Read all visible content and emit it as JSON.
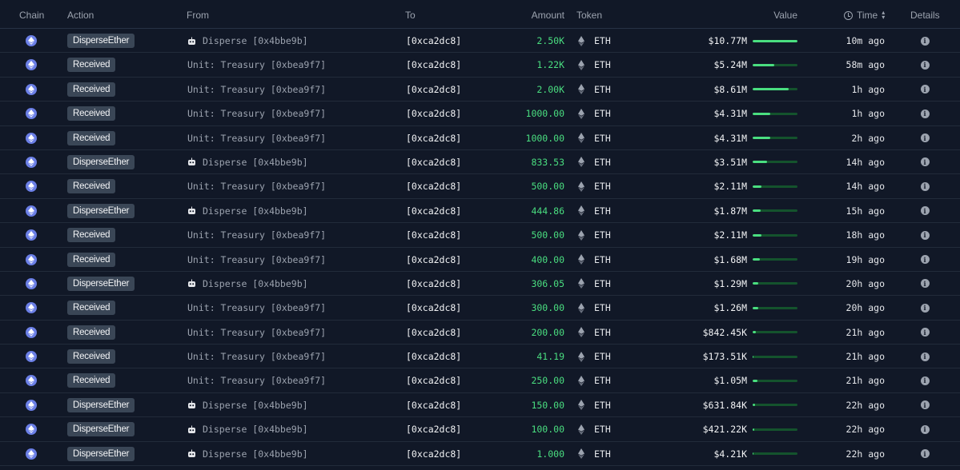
{
  "columns": {
    "chain": "Chain",
    "action": "Action",
    "from": "From",
    "to": "To",
    "amount": "Amount",
    "token": "Token",
    "value": "Value",
    "time": "Time",
    "details": "Details"
  },
  "icons": {
    "chain": "ethereum-chain-icon",
    "from_contract": "robot-icon",
    "token": "eth-diamond-icon",
    "details": "info-icon",
    "time_header": "clock-icon",
    "sort": "sort-icon"
  },
  "colors": {
    "background": "#111827",
    "amount_green": "#4ade80",
    "badge_bg": "#3a4656",
    "chain_icon": "#6b7fe6"
  },
  "rows": [
    {
      "action": "DisperseEther",
      "from": "Disperse [0x4bbe9b]",
      "from_contract": true,
      "to": "[0xca2dc8]",
      "amount": "2.50K",
      "token": "ETH",
      "value": "$10.77M",
      "value_fraction": 1.0,
      "time": "10m ago"
    },
    {
      "action": "Received",
      "from": "Unit: Treasury [0xbea9f7]",
      "from_contract": false,
      "to": "[0xca2dc8]",
      "amount": "1.22K",
      "token": "ETH",
      "value": "$5.24M",
      "value_fraction": 0.49,
      "time": "58m ago"
    },
    {
      "action": "Received",
      "from": "Unit: Treasury [0xbea9f7]",
      "from_contract": false,
      "to": "[0xca2dc8]",
      "amount": "2.00K",
      "token": "ETH",
      "value": "$8.61M",
      "value_fraction": 0.8,
      "time": "1h ago"
    },
    {
      "action": "Received",
      "from": "Unit: Treasury [0xbea9f7]",
      "from_contract": false,
      "to": "[0xca2dc8]",
      "amount": "1000.00",
      "token": "ETH",
      "value": "$4.31M",
      "value_fraction": 0.4,
      "time": "1h ago"
    },
    {
      "action": "Received",
      "from": "Unit: Treasury [0xbea9f7]",
      "from_contract": false,
      "to": "[0xca2dc8]",
      "amount": "1000.00",
      "token": "ETH",
      "value": "$4.31M",
      "value_fraction": 0.4,
      "time": "2h ago"
    },
    {
      "action": "DisperseEther",
      "from": "Disperse [0x4bbe9b]",
      "from_contract": true,
      "to": "[0xca2dc8]",
      "amount": "833.53",
      "token": "ETH",
      "value": "$3.51M",
      "value_fraction": 0.33,
      "time": "14h ago"
    },
    {
      "action": "Received",
      "from": "Unit: Treasury [0xbea9f7]",
      "from_contract": false,
      "to": "[0xca2dc8]",
      "amount": "500.00",
      "token": "ETH",
      "value": "$2.11M",
      "value_fraction": 0.2,
      "time": "14h ago"
    },
    {
      "action": "DisperseEther",
      "from": "Disperse [0x4bbe9b]",
      "from_contract": true,
      "to": "[0xca2dc8]",
      "amount": "444.86",
      "token": "ETH",
      "value": "$1.87M",
      "value_fraction": 0.17,
      "time": "15h ago"
    },
    {
      "action": "Received",
      "from": "Unit: Treasury [0xbea9f7]",
      "from_contract": false,
      "to": "[0xca2dc8]",
      "amount": "500.00",
      "token": "ETH",
      "value": "$2.11M",
      "value_fraction": 0.2,
      "time": "18h ago"
    },
    {
      "action": "Received",
      "from": "Unit: Treasury [0xbea9f7]",
      "from_contract": false,
      "to": "[0xca2dc8]",
      "amount": "400.00",
      "token": "ETH",
      "value": "$1.68M",
      "value_fraction": 0.16,
      "time": "19h ago"
    },
    {
      "action": "DisperseEther",
      "from": "Disperse [0x4bbe9b]",
      "from_contract": true,
      "to": "[0xca2dc8]",
      "amount": "306.05",
      "token": "ETH",
      "value": "$1.29M",
      "value_fraction": 0.12,
      "time": "20h ago"
    },
    {
      "action": "Received",
      "from": "Unit: Treasury [0xbea9f7]",
      "from_contract": false,
      "to": "[0xca2dc8]",
      "amount": "300.00",
      "token": "ETH",
      "value": "$1.26M",
      "value_fraction": 0.12,
      "time": "20h ago"
    },
    {
      "action": "Received",
      "from": "Unit: Treasury [0xbea9f7]",
      "from_contract": false,
      "to": "[0xca2dc8]",
      "amount": "200.00",
      "token": "ETH",
      "value": "$842.45K",
      "value_fraction": 0.08,
      "time": "21h ago"
    },
    {
      "action": "Received",
      "from": "Unit: Treasury [0xbea9f7]",
      "from_contract": false,
      "to": "[0xca2dc8]",
      "amount": "41.19",
      "token": "ETH",
      "value": "$173.51K",
      "value_fraction": 0.02,
      "time": "21h ago"
    },
    {
      "action": "Received",
      "from": "Unit: Treasury [0xbea9f7]",
      "from_contract": false,
      "to": "[0xca2dc8]",
      "amount": "250.00",
      "token": "ETH",
      "value": "$1.05M",
      "value_fraction": 0.1,
      "time": "21h ago"
    },
    {
      "action": "DisperseEther",
      "from": "Disperse [0x4bbe9b]",
      "from_contract": true,
      "to": "[0xca2dc8]",
      "amount": "150.00",
      "token": "ETH",
      "value": "$631.84K",
      "value_fraction": 0.06,
      "time": "22h ago"
    },
    {
      "action": "DisperseEther",
      "from": "Disperse [0x4bbe9b]",
      "from_contract": true,
      "to": "[0xca2dc8]",
      "amount": "100.00",
      "token": "ETH",
      "value": "$421.22K",
      "value_fraction": 0.04,
      "time": "22h ago"
    },
    {
      "action": "DisperseEther",
      "from": "Disperse [0x4bbe9b]",
      "from_contract": true,
      "to": "[0xca2dc8]",
      "amount": "1.000",
      "token": "ETH",
      "value": "$4.21K",
      "value_fraction": 0.005,
      "time": "22h ago"
    }
  ]
}
